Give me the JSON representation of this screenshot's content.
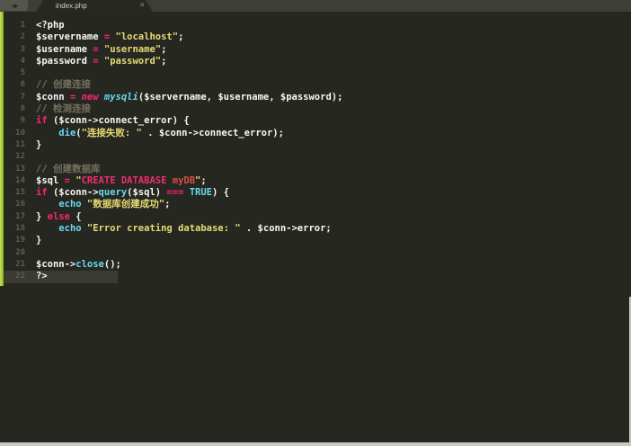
{
  "window": {
    "topbar": {
      "icon_glyph": "◀▶",
      "tab": {
        "title": "index.php",
        "close_glyph": "×"
      }
    },
    "colors": {
      "tabbar_bg": "#3f3d38",
      "editor_bg": "#272721",
      "accent_green": "#a9cc3d",
      "edge_light": "#c8c8c5",
      "current_line_bg": "#3b3b32",
      "line_number": "#5d5d53",
      "syntax_plain": "#f8f8f2",
      "syntax_keyword": "#f92672",
      "syntax_string": "#e6db74",
      "syntax_builtin": "#66d9ef",
      "syntax_comment": "#74705d",
      "syntax_sql_keyword": "#ef2f6f",
      "syntax_sql_identifier": "#cf5245"
    }
  },
  "editor": {
    "current_line": 22,
    "lines": [
      {
        "n": 1,
        "segs": [
          [
            "plain",
            "<?php"
          ]
        ]
      },
      {
        "n": 2,
        "segs": [
          [
            "plain",
            "$servername "
          ],
          [
            "keyword",
            "= "
          ],
          [
            "string",
            "\"localhost\""
          ],
          [
            "plain",
            ";"
          ]
        ]
      },
      {
        "n": 3,
        "segs": [
          [
            "plain",
            "$username "
          ],
          [
            "keyword",
            "= "
          ],
          [
            "string",
            "\"username\""
          ],
          [
            "plain",
            ";"
          ]
        ]
      },
      {
        "n": 4,
        "segs": [
          [
            "plain",
            "$password "
          ],
          [
            "keyword",
            "= "
          ],
          [
            "string",
            "\"password\""
          ],
          [
            "plain",
            ";"
          ]
        ]
      },
      {
        "n": 5,
        "segs": []
      },
      {
        "n": 6,
        "segs": [
          [
            "comment",
            "// 创建连接"
          ]
        ]
      },
      {
        "n": 7,
        "segs": [
          [
            "plain",
            "$conn "
          ],
          [
            "keyword",
            "= "
          ],
          [
            "keyword italic",
            "new "
          ],
          [
            "builtin italic",
            "mysqli"
          ],
          [
            "plain",
            "($servername, $username, $password);"
          ]
        ]
      },
      {
        "n": 8,
        "segs": [
          [
            "comment",
            "// 检测连接"
          ]
        ]
      },
      {
        "n": 9,
        "segs": [
          [
            "keyword",
            "if "
          ],
          [
            "plain",
            "($conn->connect_error) {"
          ]
        ]
      },
      {
        "n": 10,
        "segs": [
          [
            "plain",
            "    "
          ],
          [
            "builtin",
            "die"
          ],
          [
            "plain",
            "("
          ],
          [
            "string",
            "\"连接失败: \""
          ],
          [
            "plain",
            " . $conn->connect_error);"
          ]
        ]
      },
      {
        "n": 11,
        "segs": [
          [
            "plain",
            "}"
          ]
        ]
      },
      {
        "n": 12,
        "segs": []
      },
      {
        "n": 13,
        "segs": [
          [
            "comment",
            "// 创建数据库"
          ]
        ]
      },
      {
        "n": 14,
        "segs": [
          [
            "plain",
            "$sql "
          ],
          [
            "keyword",
            "= "
          ],
          [
            "string",
            "\""
          ],
          [
            "sqlkw",
            "CREATE DATABASE "
          ],
          [
            "sqlident",
            "myDB"
          ],
          [
            "string",
            "\""
          ],
          [
            "plain",
            ";"
          ]
        ]
      },
      {
        "n": 15,
        "segs": [
          [
            "keyword",
            "if "
          ],
          [
            "plain",
            "($conn->"
          ],
          [
            "builtin",
            "query"
          ],
          [
            "plain",
            "($sql) "
          ],
          [
            "keyword",
            "=== "
          ],
          [
            "builtin",
            "TRUE"
          ],
          [
            "plain",
            ") {"
          ]
        ]
      },
      {
        "n": 16,
        "segs": [
          [
            "plain",
            "    "
          ],
          [
            "builtin",
            "echo "
          ],
          [
            "string",
            "\"数据库创建成功\""
          ],
          [
            "plain",
            ";"
          ]
        ]
      },
      {
        "n": 17,
        "segs": [
          [
            "plain",
            "} "
          ],
          [
            "keyword",
            "else"
          ],
          [
            "plain",
            " {"
          ]
        ]
      },
      {
        "n": 18,
        "segs": [
          [
            "plain",
            "    "
          ],
          [
            "builtin",
            "echo "
          ],
          [
            "string",
            "\"Error creating database: \""
          ],
          [
            "plain",
            " . $conn->error;"
          ]
        ]
      },
      {
        "n": 19,
        "segs": [
          [
            "plain",
            "}"
          ]
        ]
      },
      {
        "n": 20,
        "segs": []
      },
      {
        "n": 21,
        "segs": [
          [
            "plain",
            "$conn->"
          ],
          [
            "builtin",
            "close"
          ],
          [
            "plain",
            "();"
          ]
        ]
      },
      {
        "n": 22,
        "segs": [
          [
            "plain",
            "?>"
          ]
        ]
      }
    ]
  }
}
